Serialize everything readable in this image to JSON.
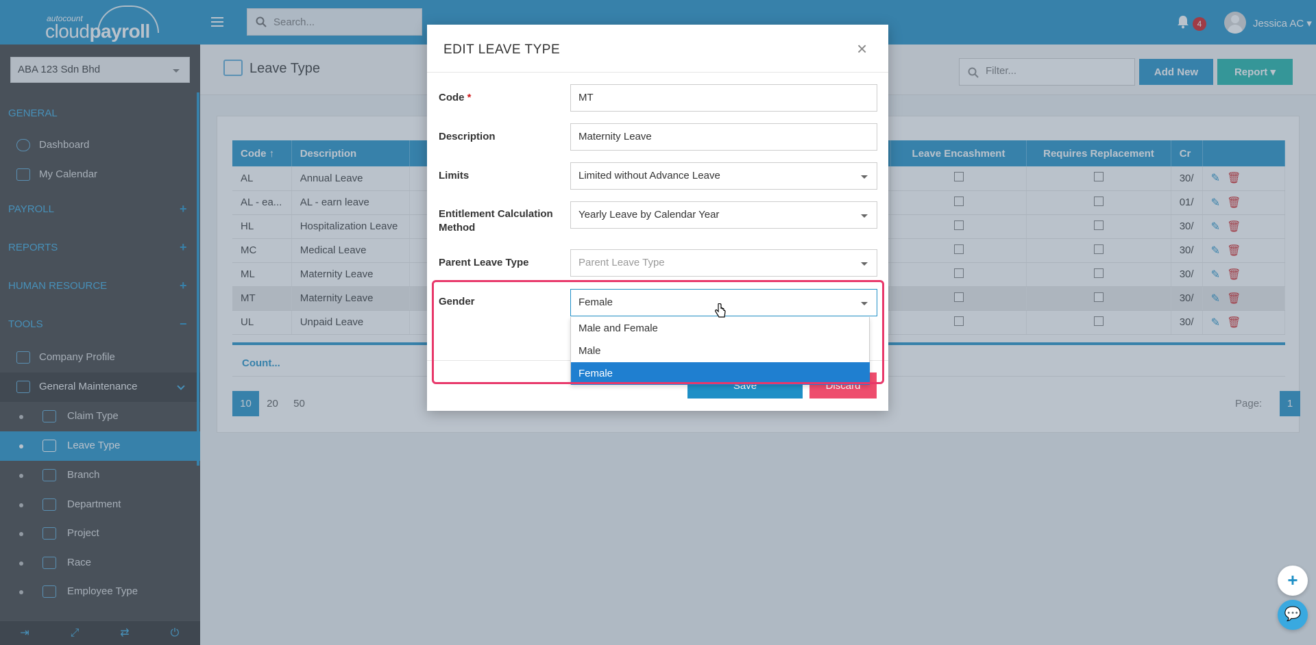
{
  "topbar": {
    "logo_small": "autocount",
    "logo_cloud": "cloud",
    "logo_payroll": "payroll",
    "search_placeholder": "Search...",
    "notification_count": "4",
    "user_name": "Jessica AC"
  },
  "sidebar": {
    "company": "ABA 123 Sdn Bhd",
    "sections": {
      "general": "GENERAL",
      "payroll": "PAYROLL",
      "reports": "REPORTS",
      "human_resource": "HUMAN RESOURCE",
      "tools": "TOOLS"
    },
    "general_items": [
      "Dashboard",
      "My Calendar"
    ],
    "tools_items": [
      "Company Profile",
      "General Maintenance"
    ],
    "sub_items": [
      "Claim Type",
      "Leave Type",
      "Branch",
      "Department",
      "Project",
      "Race",
      "Employee Type"
    ]
  },
  "page": {
    "title": "Leave Type",
    "filter_placeholder": "Filter...",
    "add_new": "Add New",
    "report": "Report"
  },
  "table": {
    "headers": [
      "Code",
      "Description",
      "",
      "Leave Encashment",
      "Requires Replacement",
      "Cr"
    ],
    "rows": [
      {
        "code": "AL",
        "desc": "Annual Leave",
        "cr": "30/"
      },
      {
        "code": "AL - ea...",
        "desc": "AL - earn leave",
        "cr": "01/"
      },
      {
        "code": "HL",
        "desc": "Hospitalization Leave",
        "cr": "30/"
      },
      {
        "code": "MC",
        "desc": "Medical Leave",
        "cr": "30/"
      },
      {
        "code": "ML",
        "desc": "Maternity Leave",
        "cr": "30/"
      },
      {
        "code": "MT",
        "desc": "Maternity Leave",
        "cr": "30/"
      },
      {
        "code": "UL",
        "desc": "Unpaid Leave",
        "cr": "30/"
      }
    ],
    "count_label": "Count...",
    "page_sizes": [
      "10",
      "20",
      "50"
    ],
    "page_label": "Page:",
    "page_number": "1"
  },
  "modal": {
    "title": "EDIT LEAVE TYPE",
    "close": "×",
    "fields": {
      "code_label": "Code",
      "code_required": "*",
      "code_value": "MT",
      "description_label": "Description",
      "description_value": "Maternity Leave",
      "limits_label": "Limits",
      "limits_value": "Limited without Advance Leave",
      "entitlement_label": "Entitlement Calculation Method",
      "entitlement_value": "Yearly Leave by Calendar Year",
      "parent_label": "Parent Leave Type",
      "parent_placeholder": "Parent Leave Type",
      "gender_label": "Gender",
      "gender_value": "Female"
    },
    "gender_options": [
      "Male and Female",
      "Male",
      "Female"
    ],
    "save": "Save",
    "discard": "Discard"
  },
  "colors": {
    "primary": "#1e8fc6",
    "sidebar": "#3d3d3d",
    "highlight": "#e8386a",
    "danger": "#d0191b",
    "report": "#1bb3a8"
  }
}
